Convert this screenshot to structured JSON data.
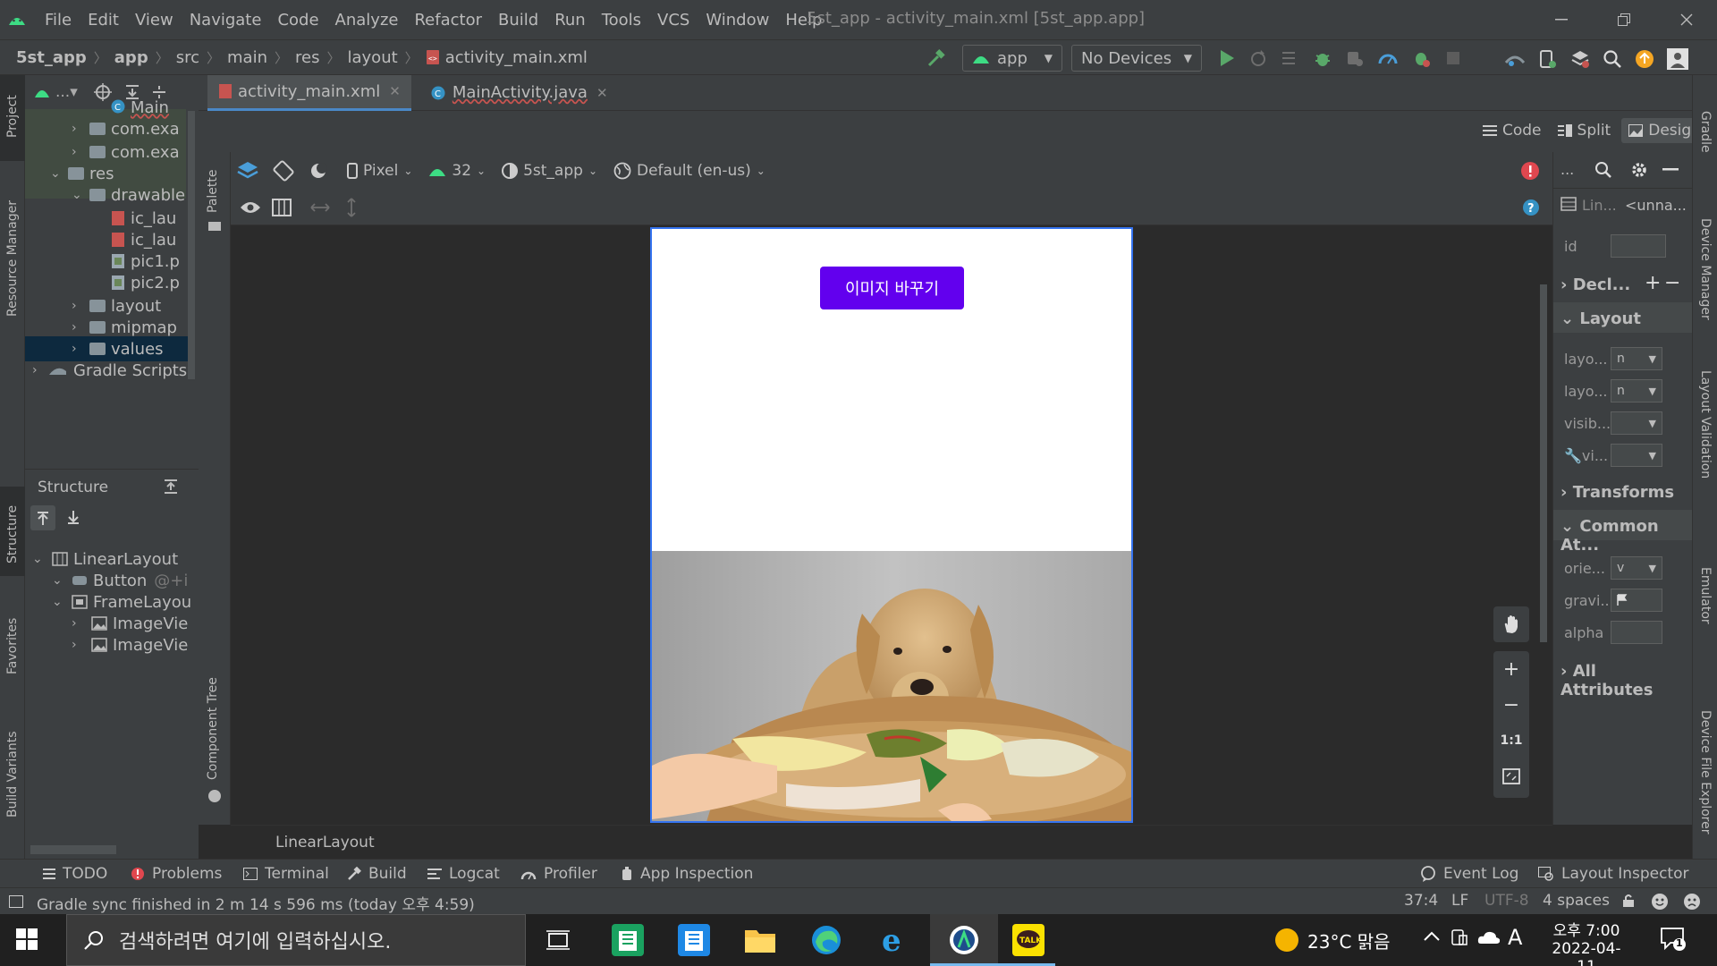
{
  "menubar": {
    "items": [
      "File",
      "Edit",
      "View",
      "Navigate",
      "Code",
      "Analyze",
      "Refactor",
      "Build",
      "Run",
      "Tools",
      "VCS",
      "Window",
      "Help"
    ],
    "window_title": "5st_app - activity_main.xml [5st_app.app]"
  },
  "navbar": {
    "breadcrumbs": [
      "5st_app",
      "app",
      "src",
      "main",
      "res",
      "layout",
      "activity_main.xml"
    ],
    "run_config": "app",
    "device": "No Devices"
  },
  "editor_tabs": [
    {
      "label": "activity_main.xml",
      "active": true
    },
    {
      "label": "MainActivity.java",
      "active": false
    }
  ],
  "view_modes": {
    "code": "Code",
    "split": "Split",
    "design": "Design"
  },
  "project_tree": [
    {
      "label": "Main",
      "indent": 4,
      "type": "class"
    },
    {
      "label": "com.exa",
      "indent": 3,
      "type": "package"
    },
    {
      "label": "com.exa",
      "indent": 3,
      "type": "package"
    },
    {
      "label": "res",
      "indent": 2,
      "type": "folder",
      "expanded": true
    },
    {
      "label": "drawable",
      "indent": 3,
      "type": "folder",
      "expanded": true
    },
    {
      "label": "ic_lau",
      "indent": 4,
      "type": "xml"
    },
    {
      "label": "ic_lau",
      "indent": 4,
      "type": "xml"
    },
    {
      "label": "pic1.p",
      "indent": 4,
      "type": "image"
    },
    {
      "label": "pic2.p",
      "indent": 4,
      "type": "image"
    },
    {
      "label": "layout",
      "indent": 3,
      "type": "folder"
    },
    {
      "label": "mipmap",
      "indent": 3,
      "type": "folder"
    },
    {
      "label": "values",
      "indent": 3,
      "type": "folder",
      "selected": true
    },
    {
      "label": "Gradle Scripts",
      "indent": 1,
      "type": "gradle"
    }
  ],
  "structure": {
    "title": "Structure",
    "items": [
      {
        "label": "LinearLayout",
        "indent": 0
      },
      {
        "label": "Button",
        "suffix": "@+i",
        "indent": 1
      },
      {
        "label": "FrameLayou",
        "indent": 1
      },
      {
        "label": "ImageVie",
        "indent": 2
      },
      {
        "label": "ImageVie",
        "indent": 2
      }
    ]
  },
  "left_strip_labels": [
    "Project",
    "Resource Manager",
    "Structure",
    "Favorites",
    "Build Variants"
  ],
  "right_strip_labels": [
    "Gradle",
    "Device Manager",
    "Layout Validation",
    "Emulator",
    "Device File Explorer"
  ],
  "palette_labels": {
    "palette": "Palette",
    "component_tree": "Component Tree"
  },
  "canvas_toolbar": {
    "device": "Pixel",
    "api": "32",
    "theme": "5st_app",
    "locale": "Default (en-us)"
  },
  "phone": {
    "button_text": "이미지 바꾸기",
    "image_desc": "dog-photo"
  },
  "zoom_controls": {
    "one_to_one": "1:1"
  },
  "attributes": {
    "header_dots": "...",
    "component": "Lin...",
    "component_id": "<unna...",
    "id_label": "id",
    "sections": {
      "declared": "Decl...",
      "layout": "Layout",
      "transforms": "Transforms",
      "common": "Common At...",
      "all": "All Attributes"
    },
    "layout_fields": [
      {
        "label": "layo...",
        "value": "n"
      },
      {
        "label": "layo...",
        "value": "n"
      },
      {
        "label": "visib...",
        "value": ""
      },
      {
        "label": "vi...",
        "value": ""
      }
    ],
    "common_fields": [
      {
        "label": "orie...",
        "value": "v"
      },
      {
        "label": "gravi...",
        "value": ""
      },
      {
        "label": "alpha",
        "value": ""
      }
    ]
  },
  "canvas_status": "LinearLayout",
  "bottom_tabs": [
    "TODO",
    "Problems",
    "Terminal",
    "Build",
    "Logcat",
    "Profiler",
    "App Inspection"
  ],
  "bottom_right_tabs": [
    "Event Log",
    "Layout Inspector"
  ],
  "status_bar": {
    "message": "Gradle sync finished in 2 m 14 s 596 ms (today 오후 4:59)",
    "position": "37:4",
    "line_sep": "LF",
    "encoding": "UTF-8",
    "indent": "4 spaces"
  },
  "taskbar": {
    "search_placeholder": "검색하려면 여기에 입력하십시오.",
    "weather": "23°C  맑음",
    "ime": "A",
    "time": "오후 7:00",
    "date": "2022-04-11",
    "notifications": "1"
  },
  "colors": {
    "ide_bg": "#2b2b2b",
    "panel_bg": "#3c3f41",
    "accent_blue": "#3574f0",
    "phone_button": "#6200ee",
    "run_green": "#59a869",
    "error_red": "#e0474f"
  }
}
